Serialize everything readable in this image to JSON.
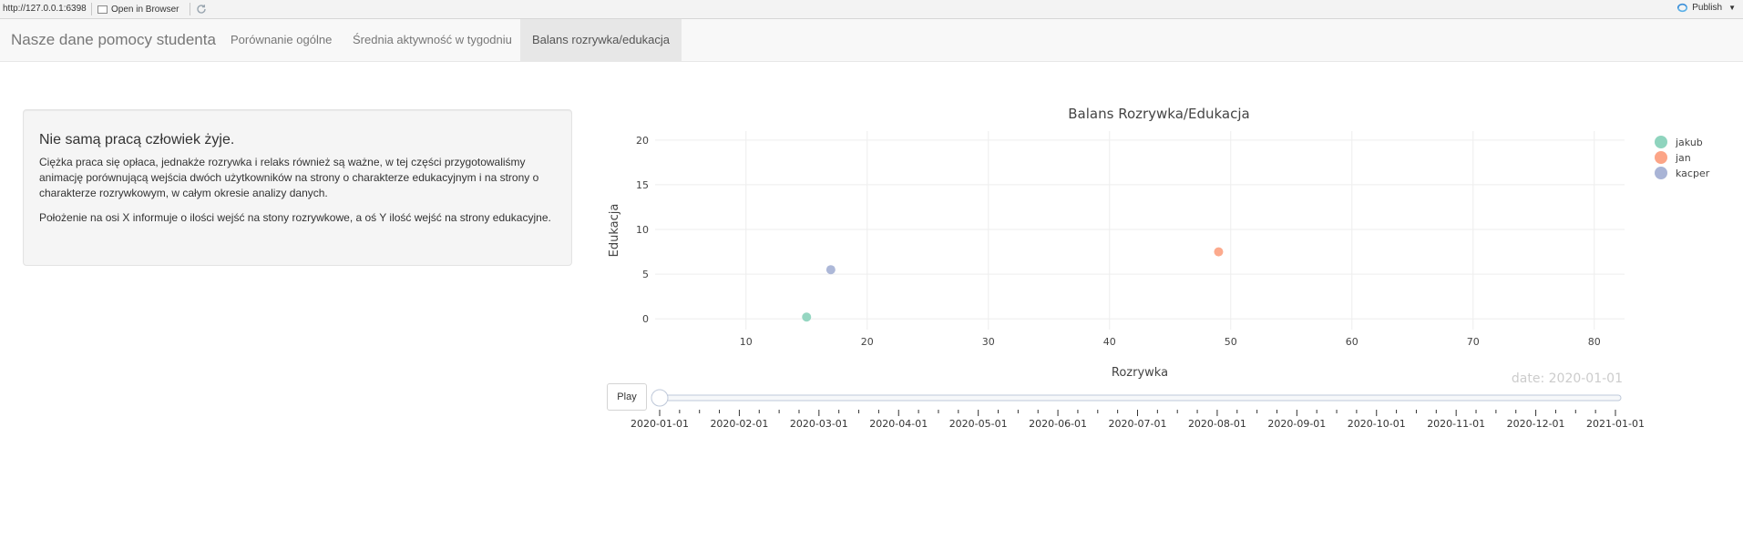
{
  "toolbar": {
    "url": "http://127.0.0.1:6398",
    "open_in_browser": "Open in Browser",
    "publish": "Publish",
    "icons": {
      "open": "window-icon",
      "refresh": "refresh-icon",
      "publish": "publish-icon",
      "caret": "caret-down-icon"
    }
  },
  "navbar": {
    "brand": "Nasze dane pomocy studenta",
    "tabs": [
      {
        "label": "Porównanie ogólne",
        "active": false
      },
      {
        "label": "Średnia aktywność w tygodniu",
        "active": false
      },
      {
        "label": "Balans rozrywka/edukacja",
        "active": true
      }
    ]
  },
  "panel": {
    "heading": "Nie samą pracą człowiek żyje.",
    "paragraph1": "Ciężka praca się opłaca, jednakże rozrywka i relaks również są ważne, w tej części przygotowaliśmy animację porównującą wejścia dwóch użytkowników na strony o charakterze edukacyjnym i na strony o charakterze rozrywkowym, w całym okresie analizy danych.",
    "paragraph2": "Położenie na osi X informuje o ilości wejść na stony rozrywkowe, a oś Y ilość wejść na strony edukacyjne."
  },
  "chart_data": {
    "type": "scatter",
    "title": "Balans Rozrywka/Edukacja",
    "xlabel": "Rozrywka",
    "ylabel": "Edukacja",
    "xlim": [
      2.5,
      82.5
    ],
    "ylim": [
      -1.2,
      21
    ],
    "xticks": [
      10,
      20,
      30,
      40,
      50,
      60,
      70,
      80
    ],
    "yticks": [
      0,
      5,
      10,
      15,
      20
    ],
    "grid": true,
    "legend_position": "top-right",
    "series": [
      {
        "name": "jakub",
        "color": "#8fd4be",
        "x": [
          15
        ],
        "y": [
          0.2
        ]
      },
      {
        "name": "jan",
        "color": "#fca587",
        "x": [
          49
        ],
        "y": [
          7.5
        ]
      },
      {
        "name": "kacper",
        "color": "#a9b4d6",
        "x": [
          17
        ],
        "y": [
          5.5
        ]
      }
    ],
    "animation": {
      "frame_label": "date: 2020-01-01",
      "play_label": "Play",
      "slider_value": 0,
      "slider_ticks": [
        "2020-01-01",
        "2020-02-01",
        "2020-03-01",
        "2020-04-01",
        "2020-05-01",
        "2020-06-01",
        "2020-07-01",
        "2020-08-01",
        "2020-09-01",
        "2020-10-01",
        "2020-11-01",
        "2020-12-01",
        "2021-01-01"
      ]
    }
  }
}
